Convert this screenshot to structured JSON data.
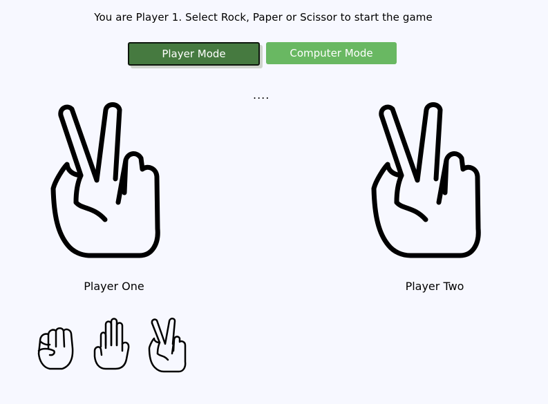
{
  "instruction": "You are Player 1. Select Rock, Paper or Scissor to start the game",
  "modes": {
    "player": "Player Mode",
    "computer": "Computer Mode",
    "active": "player"
  },
  "status": "....",
  "players": {
    "one": {
      "label": "Player One",
      "hand": "scissor-hand-icon"
    },
    "two": {
      "label": "Player Two",
      "hand": "scissor-hand-icon"
    }
  },
  "choices": [
    {
      "name": "rock",
      "icon": "rock-hand-icon"
    },
    {
      "name": "paper",
      "icon": "paper-hand-icon"
    },
    {
      "name": "scissor",
      "icon": "scissor-hand-icon"
    }
  ],
  "colors": {
    "background": "#f7f8ff",
    "player_mode_button": "#467a40",
    "computer_mode_button": "#69b862"
  }
}
